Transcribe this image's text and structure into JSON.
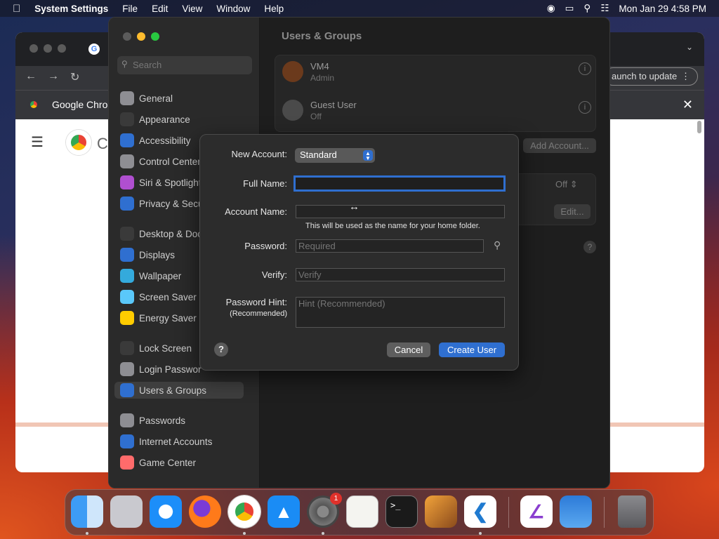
{
  "menubar": {
    "app": "System Settings",
    "menus": [
      "File",
      "Edit",
      "View",
      "Window",
      "Help"
    ],
    "clock": "Mon Jan 29  4:58 PM"
  },
  "chrome": {
    "tab_title": "Google Chrom",
    "update_text": "aunch to update",
    "page_letter": "C"
  },
  "settings": {
    "search_placeholder": "Search",
    "sidebar": [
      {
        "label": "General",
        "color": "#8e8e93"
      },
      {
        "label": "Appearance",
        "color": "#3a3a3a"
      },
      {
        "label": "Accessibility",
        "color": "#2f6fd0"
      },
      {
        "label": "Control Center",
        "color": "#8e8e93"
      },
      {
        "label": "Siri & Spotlight",
        "color": "#b04fd0"
      },
      {
        "label": "Privacy & Secu",
        "color": "#2f6fd0"
      },
      {
        "label": "Desktop & Doc",
        "color": "#3a3a3a"
      },
      {
        "label": "Displays",
        "color": "#2f6fd0"
      },
      {
        "label": "Wallpaper",
        "color": "#34aadc"
      },
      {
        "label": "Screen Saver",
        "color": "#5ac8fa"
      },
      {
        "label": "Energy Saver",
        "color": "#ffcc00"
      },
      {
        "label": "Lock Screen",
        "color": "#3a3a3a"
      },
      {
        "label": "Login Passwor",
        "color": "#8e8e93"
      },
      {
        "label": "Users & Groups",
        "color": "#2f6fd0"
      },
      {
        "label": "Passwords",
        "color": "#8e8e93"
      },
      {
        "label": "Internet Accounts",
        "color": "#2f6fd0"
      },
      {
        "label": "Game Center",
        "color": "#ff6b6b"
      }
    ],
    "pane_title": "Users & Groups",
    "users": [
      {
        "name": "VM4",
        "role": "Admin"
      },
      {
        "name": "Guest User",
        "role": "Off"
      }
    ],
    "add_account": "Add Account...",
    "auto_login_value": "Off",
    "edit_label": "Edit..."
  },
  "dialog": {
    "new_account_label": "New Account:",
    "account_type": "Standard",
    "full_name_label": "Full Name:",
    "full_name_value": "",
    "account_name_label": "Account Name:",
    "account_name_value": "",
    "home_folder_note": "This will be used as the name for your home folder.",
    "password_label": "Password:",
    "password_placeholder": "Required",
    "verify_label": "Verify:",
    "verify_placeholder": "Verify",
    "hint_label": "Password Hint:",
    "hint_sub_label": "(Recommended)",
    "hint_placeholder": "Hint (Recommended)",
    "cancel": "Cancel",
    "create": "Create User",
    "help": "?"
  },
  "dock": {
    "apps": [
      "Finder",
      "Launchpad",
      "Safari",
      "Firefox",
      "Chrome",
      "App Store",
      "System Settings",
      "TextEdit",
      "Terminal",
      "GarageBand",
      "VS Code",
      "Visual Studio",
      "Weather",
      "Trash"
    ],
    "settings_badge": "1"
  }
}
